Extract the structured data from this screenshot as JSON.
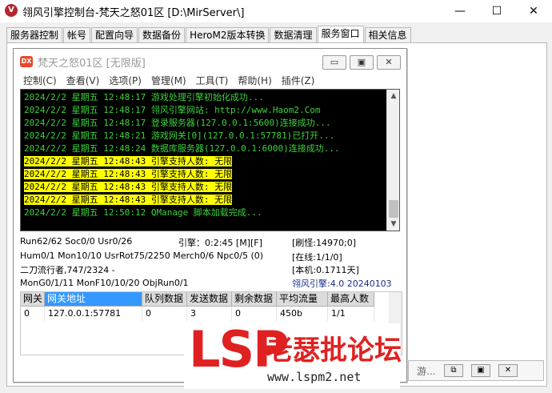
{
  "window": {
    "title": "翎风引擎控制台-梵天之怒01区 [D:\\MirServer\\]",
    "minimize": "—",
    "maximize": "☐",
    "close": "✕",
    "app_icon": "V"
  },
  "tabs": [
    {
      "label": "服务器控制",
      "active": false
    },
    {
      "label": "帐号",
      "active": false
    },
    {
      "label": "配置向导",
      "active": false
    },
    {
      "label": "数据备份",
      "active": false
    },
    {
      "label": "HeroM2版本转换",
      "active": false
    },
    {
      "label": "数据清理",
      "active": false
    },
    {
      "label": "服务窗口",
      "active": true
    },
    {
      "label": "相关信息",
      "active": false
    }
  ],
  "child": {
    "title": "梵天之怒01区 [无限版]",
    "icon_label": "DX",
    "buttons": {
      "min": "▭",
      "restore": "▣",
      "close": "✕"
    },
    "menu": [
      "控制(C)",
      "查看(V)",
      "选项(P)",
      "管理(M)",
      "工具(T)",
      "帮助(H)",
      "插件(Z)"
    ]
  },
  "log": [
    {
      "text": "2024/2/2 星期五 12:48:17 游戏处理引擎初始化成功...",
      "highlight": false
    },
    {
      "text": "2024/2/2 星期五 12:48:17 翎风引擎网站: http://www.Haom2.Com",
      "highlight": false
    },
    {
      "text": "2024/2/2 星期五 12:48:17 登录服务器(127.0.0.1:5600)连接成功...",
      "highlight": false
    },
    {
      "text": "2024/2/2 星期五 12:48:21 游戏网关[0](127.0.0.1:57781)已打开...",
      "highlight": false
    },
    {
      "text": "2024/2/2 星期五 12:48:24 数据库服务器(127.0.0.1:6000)连接成功...",
      "highlight": false
    },
    {
      "text": "2024/2/2 星期五 12:48:43 引擎支持人数: 无限",
      "highlight": true
    },
    {
      "text": "2024/2/2 星期五 12:48:43 引擎支持人数: 无限",
      "highlight": true
    },
    {
      "text": "2024/2/2 星期五 12:48:43 引擎支持人数: 无限",
      "highlight": true
    },
    {
      "text": "2024/2/2 星期五 12:48:43 引擎支持人数: 无限",
      "highlight": true
    },
    {
      "text": "2024/2/2 星期五 12:50:12 QManage 脚本加载完成...",
      "highlight": false
    }
  ],
  "status": {
    "run": "Run62/62 Soc0/0 Usr0/26",
    "engine_time": "引擎：0:2:45 [M][F]",
    "refresh": "[刷怪:14970;0]",
    "hum": "Hum0/1 Mon10/10 UsrRot75/2250 Merch0/6 Npc0/5 (0)",
    "online": "[在线:1/1/0]",
    "player": "二刀流行者,747/2324 -",
    "local": "[本机:0.1711天]",
    "mon": "MonG0/1/11 MonF10/10/20 ObjRun0/1",
    "version": "翎风引擎:4.0 20240103"
  },
  "gateway_table": {
    "headers": [
      "网关",
      "网关地址",
      "队列数据",
      "发送数据",
      "剩余数据",
      "平均流量",
      "最高人数"
    ],
    "rows": [
      [
        "0",
        "127.0.0.1:57781",
        "0",
        "3",
        "0",
        "450b",
        "1/1"
      ]
    ]
  },
  "watermark": {
    "brand": "LSP",
    "cn": "老瑟批论坛",
    "url": "www.lspm2.net"
  },
  "minimized_window": {
    "label": "游...",
    "restore": "⧉",
    "max": "▣",
    "close": "✕"
  }
}
